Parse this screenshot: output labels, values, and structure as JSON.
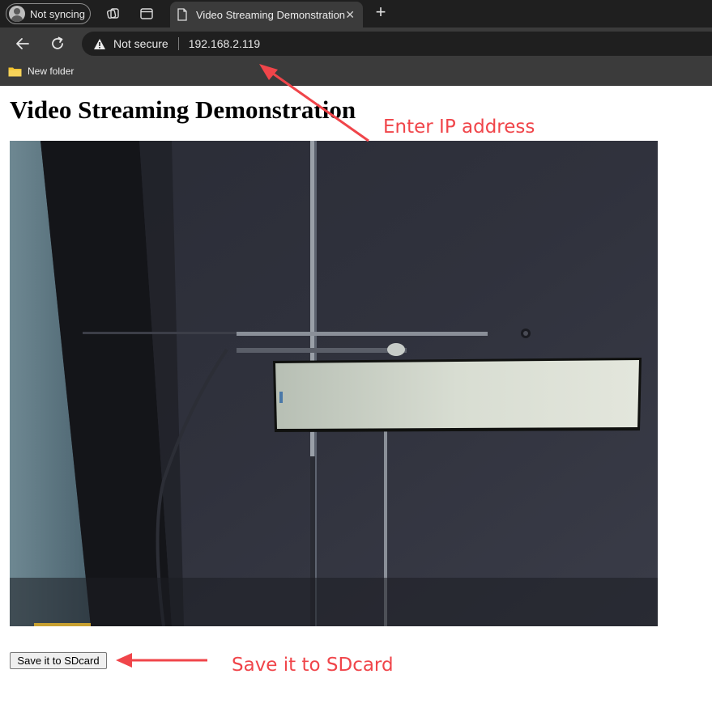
{
  "browser": {
    "profile_label": "Not syncing",
    "tab_title": "Video Streaming Demonstration",
    "security_label": "Not secure",
    "url": "192.168.2.119",
    "bookmark_label": "New folder"
  },
  "page": {
    "heading": "Video Streaming Demonstration",
    "save_button_label": "Save it to SDcard"
  },
  "annotations": {
    "ip_note": "Enter IP address",
    "save_note": "Save it to SDcard",
    "color": "#f0454a"
  },
  "icons": [
    "avatar-icon",
    "workspaces-icon",
    "tab-search-icon",
    "document-icon",
    "close-icon",
    "plus-icon",
    "back-arrow-icon",
    "reload-icon",
    "warning-icon",
    "folder-icon"
  ],
  "colors": {
    "tab_strip": "#1f1f1f",
    "toolbar": "#3b3b3b",
    "omnibox": "#1f1f1f",
    "folder": "#f2c12e"
  }
}
